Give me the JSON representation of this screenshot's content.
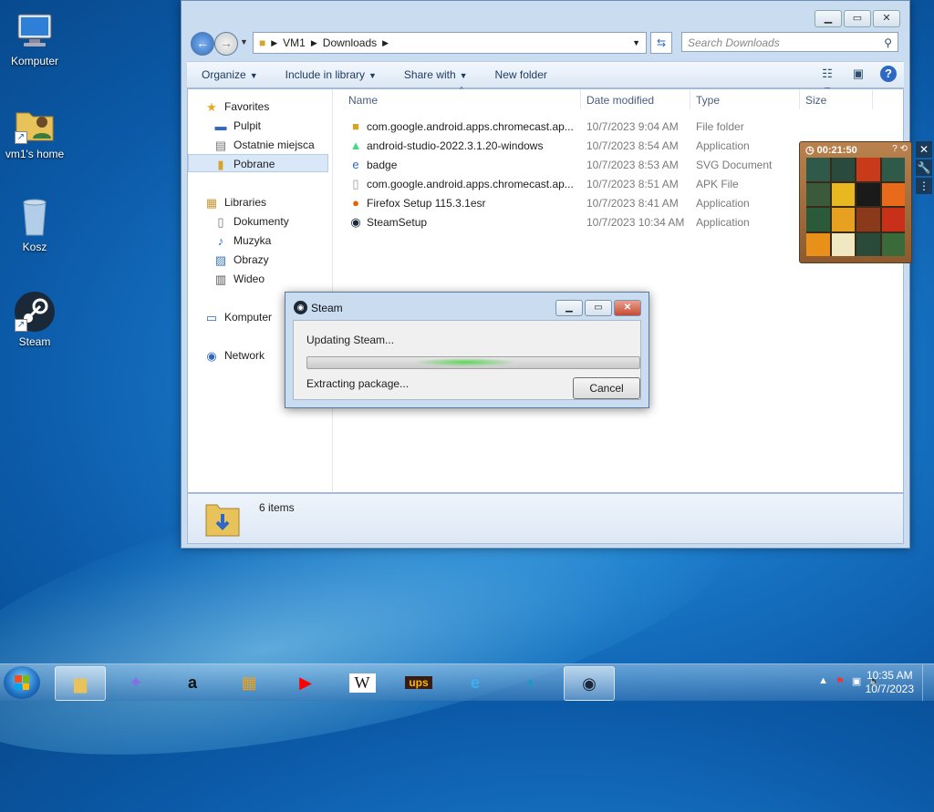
{
  "desktop": {
    "icons": [
      {
        "label": "Komputer"
      },
      {
        "label": "vm1's home"
      },
      {
        "label": "Kosz"
      },
      {
        "label": "Steam"
      }
    ]
  },
  "explorer": {
    "breadcrumb": [
      "VM1",
      "Downloads"
    ],
    "search_placeholder": "Search Downloads",
    "toolbar": {
      "organize": "Organize",
      "include": "Include in library",
      "share": "Share with",
      "new_folder": "New folder"
    },
    "nav": {
      "favorites": "Favorites",
      "pulpit": "Pulpit",
      "ostatnie": "Ostatnie miejsca",
      "pobrane": "Pobrane",
      "libraries": "Libraries",
      "dokumenty": "Dokumenty",
      "muzyka": "Muzyka",
      "obrazy": "Obrazy",
      "wideo": "Wideo",
      "komputer": "Komputer",
      "network": "Network"
    },
    "columns": {
      "name": "Name",
      "date": "Date modified",
      "type": "Type",
      "size": "Size"
    },
    "files": [
      {
        "name": "com.google.android.apps.chromecast.ap...",
        "date": "10/7/2023 9:04 AM",
        "type": "File folder",
        "icon": "folder-icon"
      },
      {
        "name": "android-studio-2022.3.1.20-windows",
        "date": "10/7/2023 8:54 AM",
        "type": "Application",
        "icon": "android-icon"
      },
      {
        "name": "badge",
        "date": "10/7/2023 8:53 AM",
        "type": "SVG Document",
        "icon": "edge-icon"
      },
      {
        "name": "com.google.android.apps.chromecast.ap...",
        "date": "10/7/2023 8:51 AM",
        "type": "APK File",
        "icon": "file-icon"
      },
      {
        "name": "Firefox Setup 115.3.1esr",
        "date": "10/7/2023 8:41 AM",
        "type": "Application",
        "icon": "firefox-icon"
      },
      {
        "name": "SteamSetup",
        "date": "10/7/2023 10:34 AM",
        "type": "Application",
        "icon": "steam-icon"
      }
    ],
    "details": {
      "count": "6 items"
    }
  },
  "steam_dialog": {
    "title": "Steam",
    "status": "Updating Steam...",
    "substatus": "Extracting package...",
    "cancel": "Cancel",
    "progress": 0.5
  },
  "gadget": {
    "timer": "00:21:50"
  },
  "taskbar": {
    "clock_time": "10:35 AM",
    "clock_date": "10/7/2023"
  },
  "colors": {
    "accent": "#2e68c4",
    "steam_progress": "#5ed65a"
  }
}
